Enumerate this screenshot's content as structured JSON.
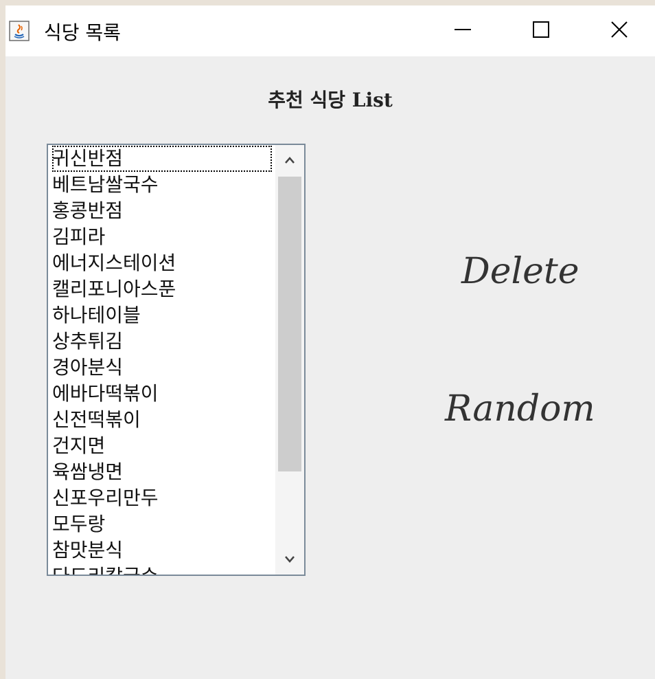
{
  "window": {
    "title": "식당 목록",
    "app_icon": "java-icon",
    "controls": {
      "minimize": "minimize-icon",
      "maximize": "maximize-icon",
      "close": "close-icon"
    }
  },
  "heading": "추천 식당 List",
  "restaurant_list": {
    "selected_index": 0,
    "items": [
      "귀신반점",
      "베트남쌀국수",
      "홍콩반점",
      "김피라",
      "에너지스테이션",
      "캘리포니아스푼",
      "하나테이블",
      "상추튀김",
      "경아분식",
      "에바다떡볶이",
      "신전떡볶이",
      "건지면",
      "육쌈냉면",
      "신포우리만두",
      "모두랑",
      "참맛분식",
      "다도리칼국수"
    ]
  },
  "buttons": {
    "delete_label": "Delete",
    "random_label": "Random"
  },
  "colors": {
    "client_bg": "#eeeeee",
    "titlebar_bg": "#ffffff",
    "list_border": "#7a8a99",
    "scroll_thumb": "#cdcdcd"
  }
}
